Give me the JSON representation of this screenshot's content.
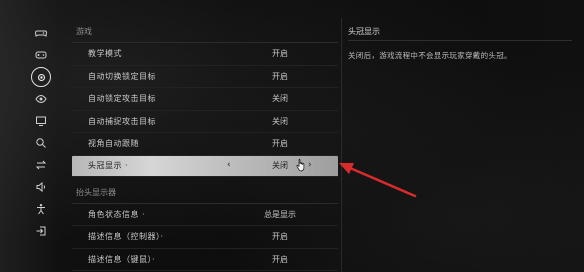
{
  "sidebar": {
    "items": [
      {
        "icon": "gamepad-icon"
      },
      {
        "icon": "controller-icon"
      },
      {
        "icon": "target-icon",
        "active": true
      },
      {
        "icon": "eye-icon"
      },
      {
        "icon": "monitor-icon"
      },
      {
        "icon": "search-icon"
      },
      {
        "icon": "swap-arrows-icon"
      },
      {
        "icon": "speaker-icon"
      },
      {
        "icon": "person-icon"
      },
      {
        "icon": "exit-icon"
      }
    ]
  },
  "main": {
    "section1": "游戏",
    "rows1": [
      {
        "label": "教学模式",
        "value": "开启"
      },
      {
        "label": "自动切换锁定目标",
        "value": "开启"
      },
      {
        "label": "自动锁定攻击目标",
        "value": "关闭"
      },
      {
        "label": "自动捕捉攻击目标",
        "value": "关闭"
      },
      {
        "label": "视角自动跟随",
        "value": "开启"
      }
    ],
    "selected": {
      "label": "头冠显示 ·",
      "value": "关闭",
      "left_arrow": "‹",
      "right_arrow": "›"
    },
    "section2": "抬头显示器",
    "rows2": [
      {
        "label": "角色状态信息 ·",
        "value": "总是显示"
      },
      {
        "label": "描述信息（控制器）·",
        "value": "开启"
      },
      {
        "label": "描述信息（键鼠）·",
        "value": "开启"
      }
    ]
  },
  "description": {
    "title": "头冠显示",
    "text": "关闭后，游戏流程中不会显示玩家穿戴的头冠。"
  },
  "colors": {
    "annotation_arrow": "#d92b2b",
    "selected_bg": "#c4c4c4"
  }
}
